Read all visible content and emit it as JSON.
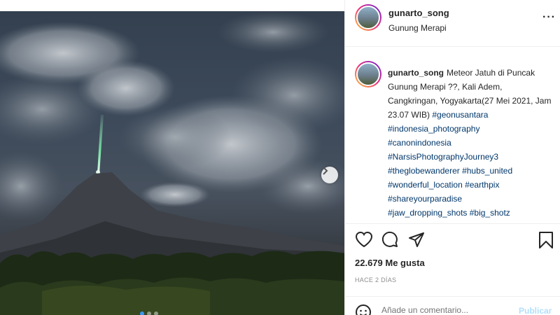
{
  "post": {
    "username": "gunarto_song",
    "location": "Gunung Merapi",
    "caption_text": "Meteor Jatuh di Puncak Gunung Merapi ??, Kali Adem, Cangkringan, Yogyakarta(27 Mei 2021, Jam 23.07 WIB)",
    "caption_inline_tag": "#geonusantara",
    "hashtags": [
      "#indonesia_photography",
      "#canonindonesia",
      "#NarsisPhotographyJourney3",
      "#theglobewanderer #hubs_united",
      "#wonderful_location #earthpix",
      "#shareyourparadise",
      "#jaw_dropping_shots #big_shotz"
    ],
    "likes": "22.679 Me gusta",
    "date": "HACE 2 DÍAS",
    "more_label": "···"
  },
  "comment": {
    "placeholder": "Añade un comentario...",
    "publish_label": "Publicar"
  },
  "carousel": {
    "slide_count": 3,
    "active_slide": 1
  },
  "icons": {
    "like": "heart-icon",
    "comment": "comment-icon",
    "share": "share-icon",
    "save": "bookmark-icon",
    "next": "chevron-right-icon",
    "emoji": "smiley-icon"
  },
  "colors": {
    "hashtag": "#00376b",
    "carousel_active": "#3897f0",
    "publish_disabled": "#b2dffc",
    "meteor": "#7dffb0"
  }
}
